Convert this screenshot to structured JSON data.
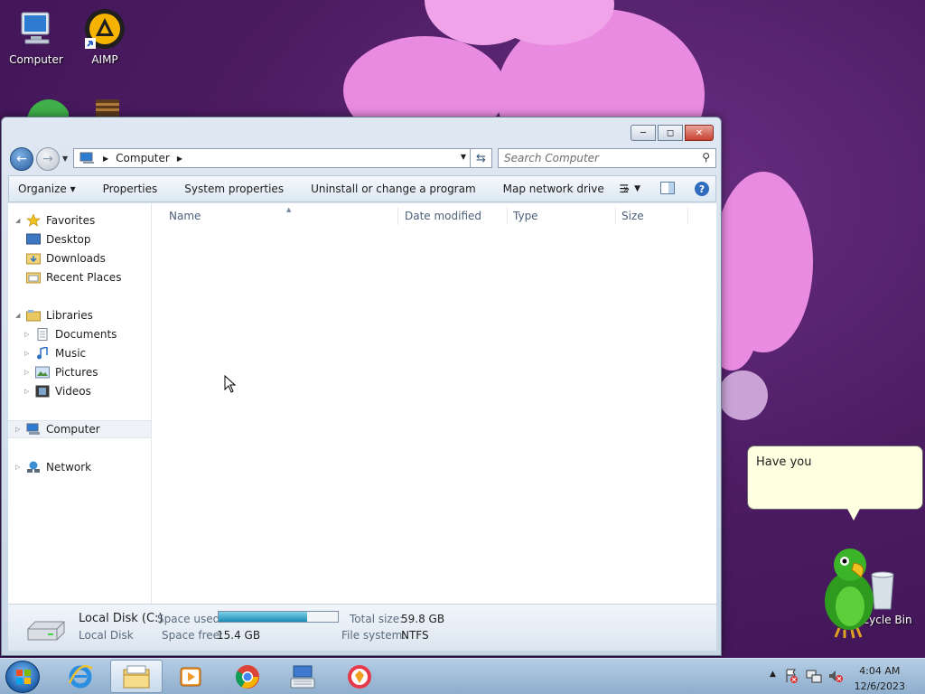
{
  "desktop": {
    "icons": [
      {
        "label": "Computer",
        "icon": "computer-icon"
      },
      {
        "label": "AIMP",
        "icon": "aimp-icon"
      },
      {
        "label": "Recycle Bin",
        "icon": "recycle-bin-icon"
      }
    ]
  },
  "window": {
    "caption_buttons": {
      "minimize": "minimize-icon",
      "maximize": "maximize-icon",
      "close": "close-icon"
    },
    "address": {
      "segments": [
        "Computer"
      ]
    },
    "search": {
      "placeholder": "Search Computer"
    },
    "toolbar": {
      "organize": "Organize",
      "properties": "Properties",
      "system_properties": "System properties",
      "uninstall": "Uninstall or change a program",
      "map_network_drive": "Map network drive",
      "more": "»",
      "help": "?"
    },
    "nav_pane": {
      "favorites": "Favorites",
      "desktop": "Desktop",
      "downloads": "Downloads",
      "recent_places": "Recent Places",
      "libraries": "Libraries",
      "documents": "Documents",
      "music": "Music",
      "pictures": "Pictures",
      "videos": "Videos",
      "computer": "Computer",
      "network": "Network"
    },
    "columns": {
      "name": "Name",
      "date_modified": "Date modified",
      "type": "Type",
      "size": "Size"
    },
    "details": {
      "drive_name": "Local Disk (C:)",
      "drive_type": "Local Disk",
      "space_used_label": "Space used:",
      "space_used_fraction": 0.74,
      "space_free_label": "Space free:",
      "space_free": "15.4 GB",
      "total_size_label": "Total size:",
      "total_size": "59.8 GB",
      "file_system_label": "File system:",
      "file_system": "NTFS"
    }
  },
  "assistant": {
    "message": "Have you"
  },
  "taskbar": {
    "apps": [
      "internet-explorer-icon",
      "file-explorer-icon",
      "media-player-icon",
      "chrome-icon",
      "keyboard-icon",
      "vpn-icon"
    ],
    "clock": {
      "time": "4:04 AM",
      "date": "12/6/2023"
    }
  },
  "colors": {
    "accent": "#2b5f9e",
    "progress": "#1b8bb4",
    "petal": "#e98be0"
  }
}
